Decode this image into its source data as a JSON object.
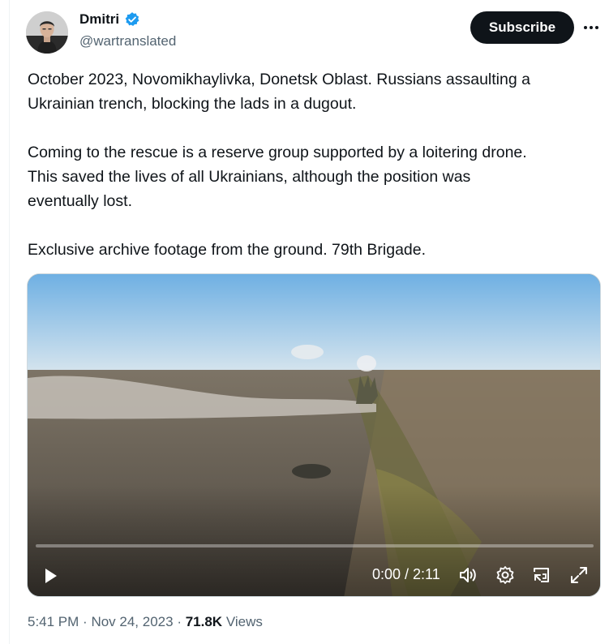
{
  "author": {
    "display_name": "Dmitri",
    "handle": "@wartranslated",
    "verified": true,
    "avatar_icon": "person-photo-icon"
  },
  "actions": {
    "subscribe_label": "Subscribe",
    "more_icon": "more-horizontal-icon"
  },
  "tweet": {
    "paragraphs": [
      [
        "October 2023, Novomikhaylivka, Donetsk Oblast. Russians assaulting a",
        "Ukrainian trench, blocking the lads in a dugout."
      ],
      [
        "Coming to the rescue is a reserve group supported by a loitering drone.",
        "This saved the lives of all Ukrainians, although the position was",
        "eventually lost."
      ],
      [
        "Exclusive archive footage from the ground. 79th Brigade."
      ]
    ]
  },
  "video": {
    "current_time": "0:00",
    "duration": "2:11",
    "time_display": "0:00 / 2:11",
    "progress": 0,
    "icons": [
      "play-icon",
      "volume-icon",
      "settings-gear-icon",
      "picture-in-picture-icon",
      "fullscreen-expand-icon"
    ]
  },
  "meta": {
    "time": "5:41 PM",
    "date": "Nov 24, 2023",
    "views_count": "71.8K",
    "views_label": "Views"
  },
  "colors": {
    "accent": "#1d9bf0",
    "subscribe_bg": "#0f1419",
    "secondary_text": "#536471"
  }
}
